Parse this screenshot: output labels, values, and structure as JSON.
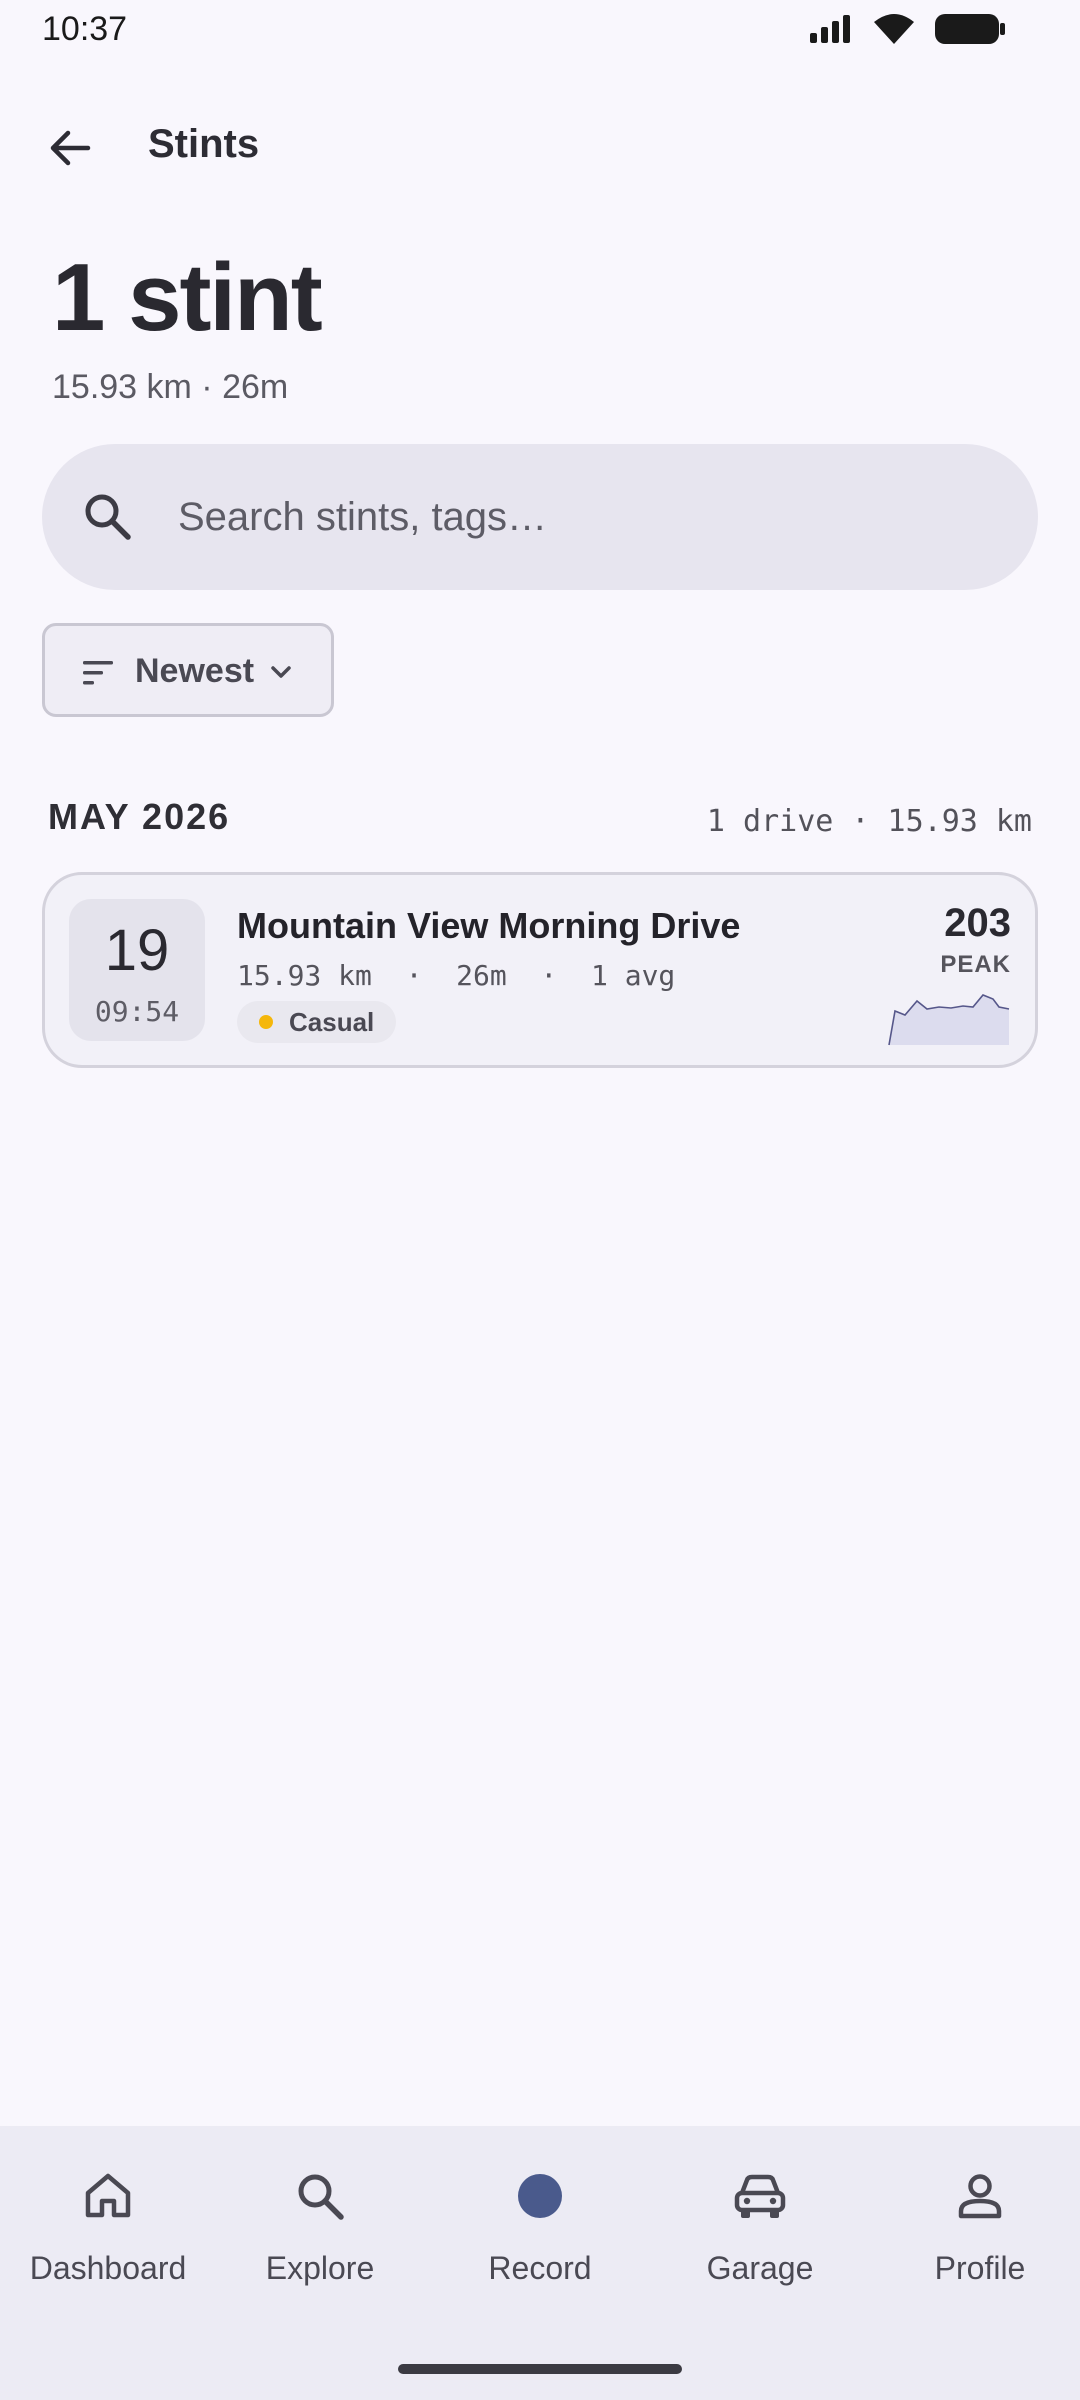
{
  "status_bar": {
    "time": "10:37",
    "icons": [
      "signal-icon",
      "wifi-icon",
      "battery-icon"
    ]
  },
  "app_bar": {
    "title": "Stints",
    "back_icon": "arrow-back-icon"
  },
  "summary": {
    "headline": "1 stint",
    "subline": "15.93 km · 26m"
  },
  "search": {
    "placeholder": "Search stints, tags…",
    "value": ""
  },
  "sort": {
    "label": "Newest"
  },
  "sections": [
    {
      "month": "MAY 2026",
      "summary": "1 drive · 15.93 km",
      "stints": [
        {
          "day": "19",
          "time": "09:54",
          "title": "Mountain View Morning Drive",
          "meta": "15.93 km  ·  26m  ·  1 avg",
          "tag": "Casual",
          "tag_color": "#f5b70b",
          "peak_value": "203",
          "peak_label": "PEAK"
        }
      ]
    }
  ],
  "bottom_nav": {
    "items": [
      {
        "label": "Dashboard",
        "icon": "home-icon"
      },
      {
        "label": "Explore",
        "icon": "search-icon"
      },
      {
        "label": "Record",
        "icon": "record-icon"
      },
      {
        "label": "Garage",
        "icon": "car-icon"
      },
      {
        "label": "Profile",
        "icon": "person-icon"
      }
    ]
  },
  "colors": {
    "background": "#f9f7fd",
    "accent": "#4a5a8c",
    "tag_casual": "#f5b70b"
  }
}
